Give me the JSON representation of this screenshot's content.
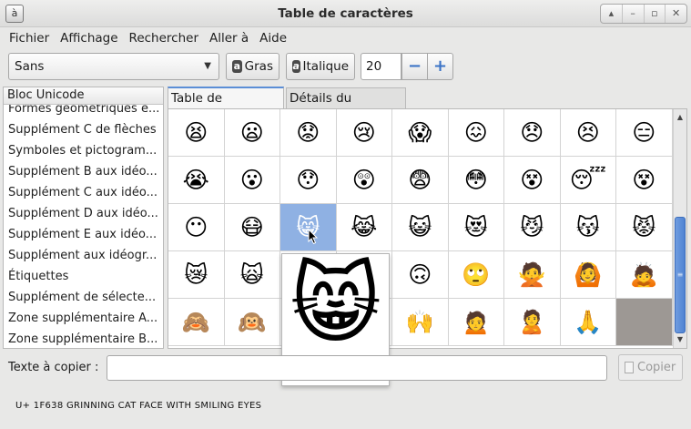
{
  "window": {
    "title": "Table de caractères",
    "app_icon_glyph": "à",
    "buttons": [
      "▴",
      "–",
      "▫",
      "✕"
    ]
  },
  "menu": [
    "Fichier",
    "Affichage",
    "Rechercher",
    "Aller à",
    "Aide"
  ],
  "toolbar": {
    "font_name": "Sans",
    "bold_label": "Gras",
    "italic_label": "Italique",
    "font_size": "20",
    "minus": "−",
    "plus": "+"
  },
  "sidebar": {
    "header": "Bloc Unicode",
    "items": [
      "Formes géométriques é...",
      "Supplément C de flèches",
      "Symboles et pictogram...",
      "Supplément B aux idéo...",
      "Supplément C aux idéo...",
      "Supplément D aux idéo...",
      "Supplément E aux idéo...",
      "Supplément aux idéogr...",
      "Étiquettes",
      "Supplément de sélecte...",
      "Zone supplémentaire A...",
      "Zone supplémentaire B..."
    ]
  },
  "tabs": {
    "chars": "Table de caractères",
    "details": "Détails du caractère"
  },
  "grid": [
    [
      "😫",
      "😦",
      "😟",
      "😢",
      "😱",
      "😖",
      "😞",
      "😣",
      "😑"
    ],
    [
      "😭",
      "😮",
      "😯",
      "😲",
      "😨",
      "😳",
      "😵",
      "😴",
      "😵"
    ],
    [
      "😶",
      "😷",
      "😸",
      "😹",
      "😺",
      "😻",
      "😼",
      "😽",
      "😾"
    ],
    [
      "😿",
      "🙀",
      "",
      "",
      "🙃",
      "🙄",
      "🙅",
      "🙆",
      "🙇"
    ],
    [
      "🙈",
      "🙉",
      "",
      "",
      "🙌",
      "🙍",
      "🙎",
      "🙏",
      ""
    ]
  ],
  "selected_char": "😸",
  "zoom": {
    "glyph": "😸",
    "font": "DejaVu Sans"
  },
  "copy": {
    "label": "Texte à copier :",
    "value": "",
    "button": "Copier"
  },
  "status": "U+ 1F638 GRINNING CAT FACE WITH SMILING EYES"
}
